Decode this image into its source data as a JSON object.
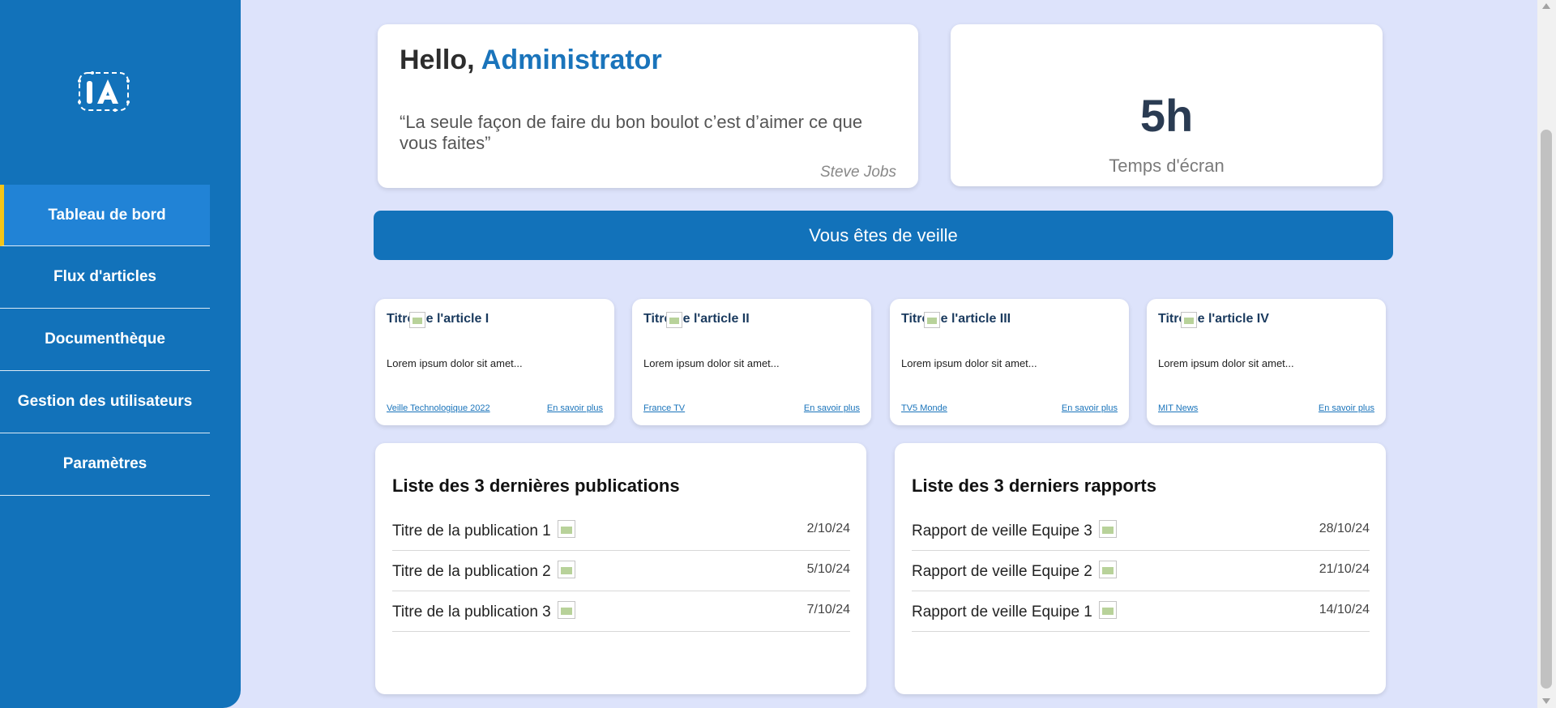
{
  "sidebar": {
    "logo": "IA",
    "items": [
      {
        "label": "Tableau de bord",
        "active": true
      },
      {
        "label": "Flux d'articles"
      },
      {
        "label": "Documenthèque"
      },
      {
        "label": "Gestion des utilisateurs"
      },
      {
        "label": "Paramètres"
      }
    ]
  },
  "greeting": {
    "hello": "Hello,",
    "name": "Administrator",
    "quote": "“La seule façon de faire du bon boulot c’est d’aimer ce que vous faites”",
    "author": "Steve Jobs"
  },
  "screen_time": {
    "value": "5h",
    "label": "Temps d'écran"
  },
  "banner": {
    "label": "Vous êtes de veille"
  },
  "articles": [
    {
      "title": "Titre de l'article I",
      "desc": "Lorem ipsum dolor sit amet...",
      "source": "Veille Technologique 2022",
      "more": "En savoir plus"
    },
    {
      "title": "Titre de l'article II",
      "desc": "Lorem ipsum dolor sit amet...",
      "source": "France TV",
      "more": "En savoir plus"
    },
    {
      "title": "Titre de l'article III",
      "desc": "Lorem ipsum dolor sit amet...",
      "source": "TV5 Monde",
      "more": "En savoir plus"
    },
    {
      "title": "Titre de l'article IV",
      "desc": "Lorem ipsum dolor sit amet...",
      "source": "MIT News",
      "more": "En savoir plus"
    }
  ],
  "publications": {
    "title": "Liste des 3 dernières publications",
    "rows": [
      {
        "name": "Titre de la publication 1",
        "date": "2/10/24"
      },
      {
        "name": "Titre de la publication 2",
        "date": "5/10/24"
      },
      {
        "name": "Titre de la publication 3",
        "date": "7/10/24"
      }
    ]
  },
  "reports": {
    "title": "Liste des 3 derniers rapports",
    "rows": [
      {
        "name": "Rapport de veille Equipe 3",
        "date": "28/10/24"
      },
      {
        "name": "Rapport de veille Equipe 2",
        "date": "21/10/24"
      },
      {
        "name": "Rapport de veille Equipe 1",
        "date": "14/10/24"
      }
    ]
  }
}
